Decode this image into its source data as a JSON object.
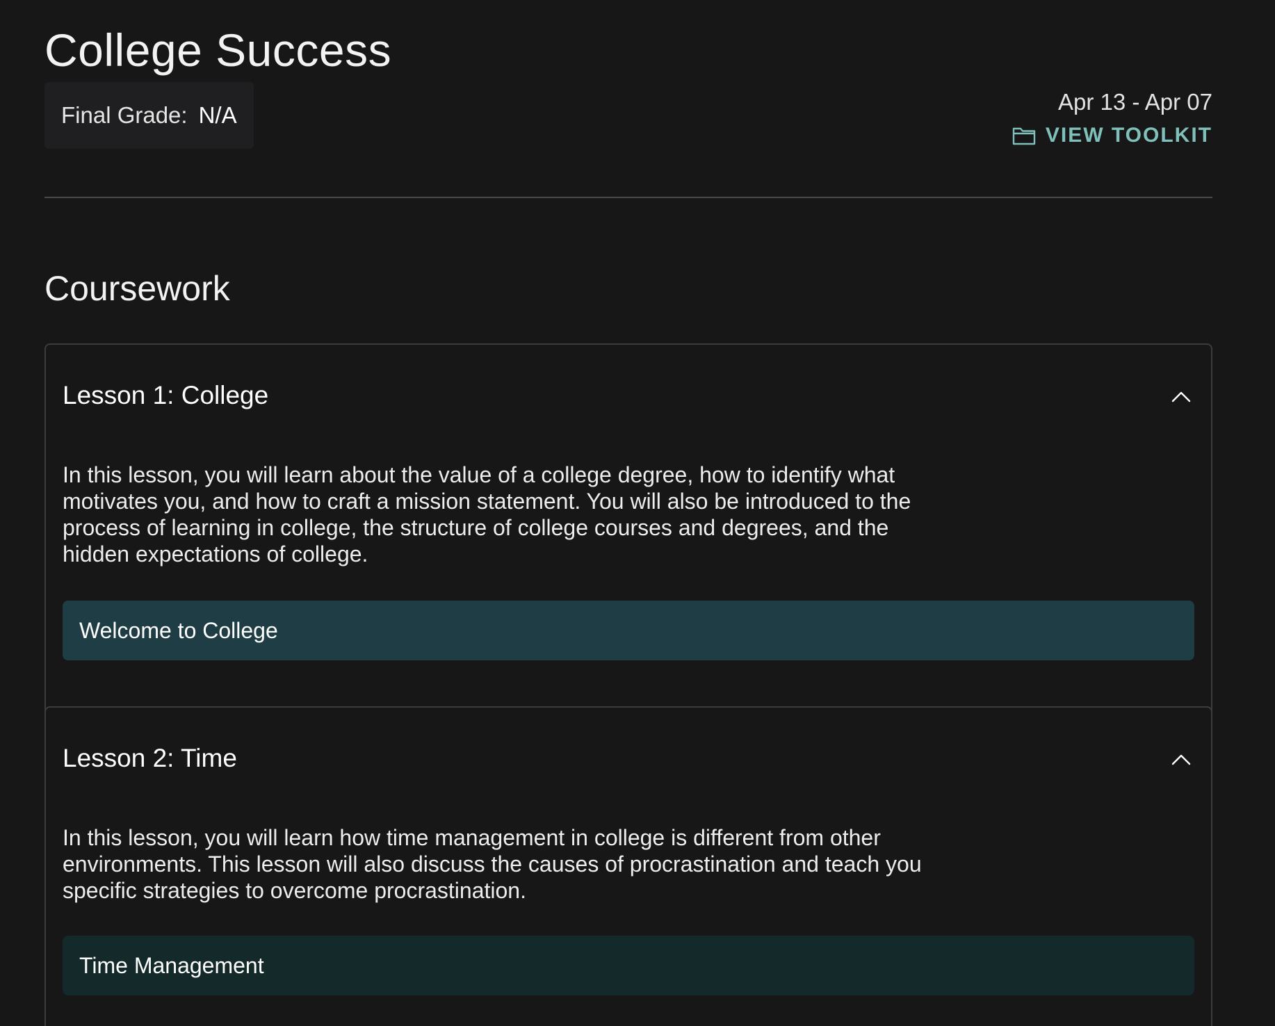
{
  "course": {
    "title": "College Success",
    "grade_label": "Final Grade:",
    "grade_value": "N/A",
    "date_range": "Apr 13 - Apr 07",
    "toolkit_label": "VIEW TOOLKIT",
    "toolkit_icon": "folder-icon"
  },
  "coursework": {
    "heading": "Coursework",
    "lessons": [
      {
        "title": "Lesson 1: College",
        "description": "In this lesson, you will learn about the value of a college degree, how to identify what motivates you, and how to craft a mission statement. You will also be introduced to the process of learning in college, the structure of college courses and degrees, and the hidden expectations of college.",
        "activity": "Welcome to College",
        "expanded": true
      },
      {
        "title": "Lesson 2: Time",
        "description": "In this lesson, you will learn how time management in college is different from other environments. This lesson will also discuss the causes of procrastination and teach you specific strategies to overcome procrastination.",
        "activity": "Time Management",
        "expanded": true
      }
    ]
  },
  "colors": {
    "background": "#171717",
    "accent": "#7fc0bb",
    "activity_primary": "#1f3d45",
    "activity_secondary": "#13292a"
  }
}
